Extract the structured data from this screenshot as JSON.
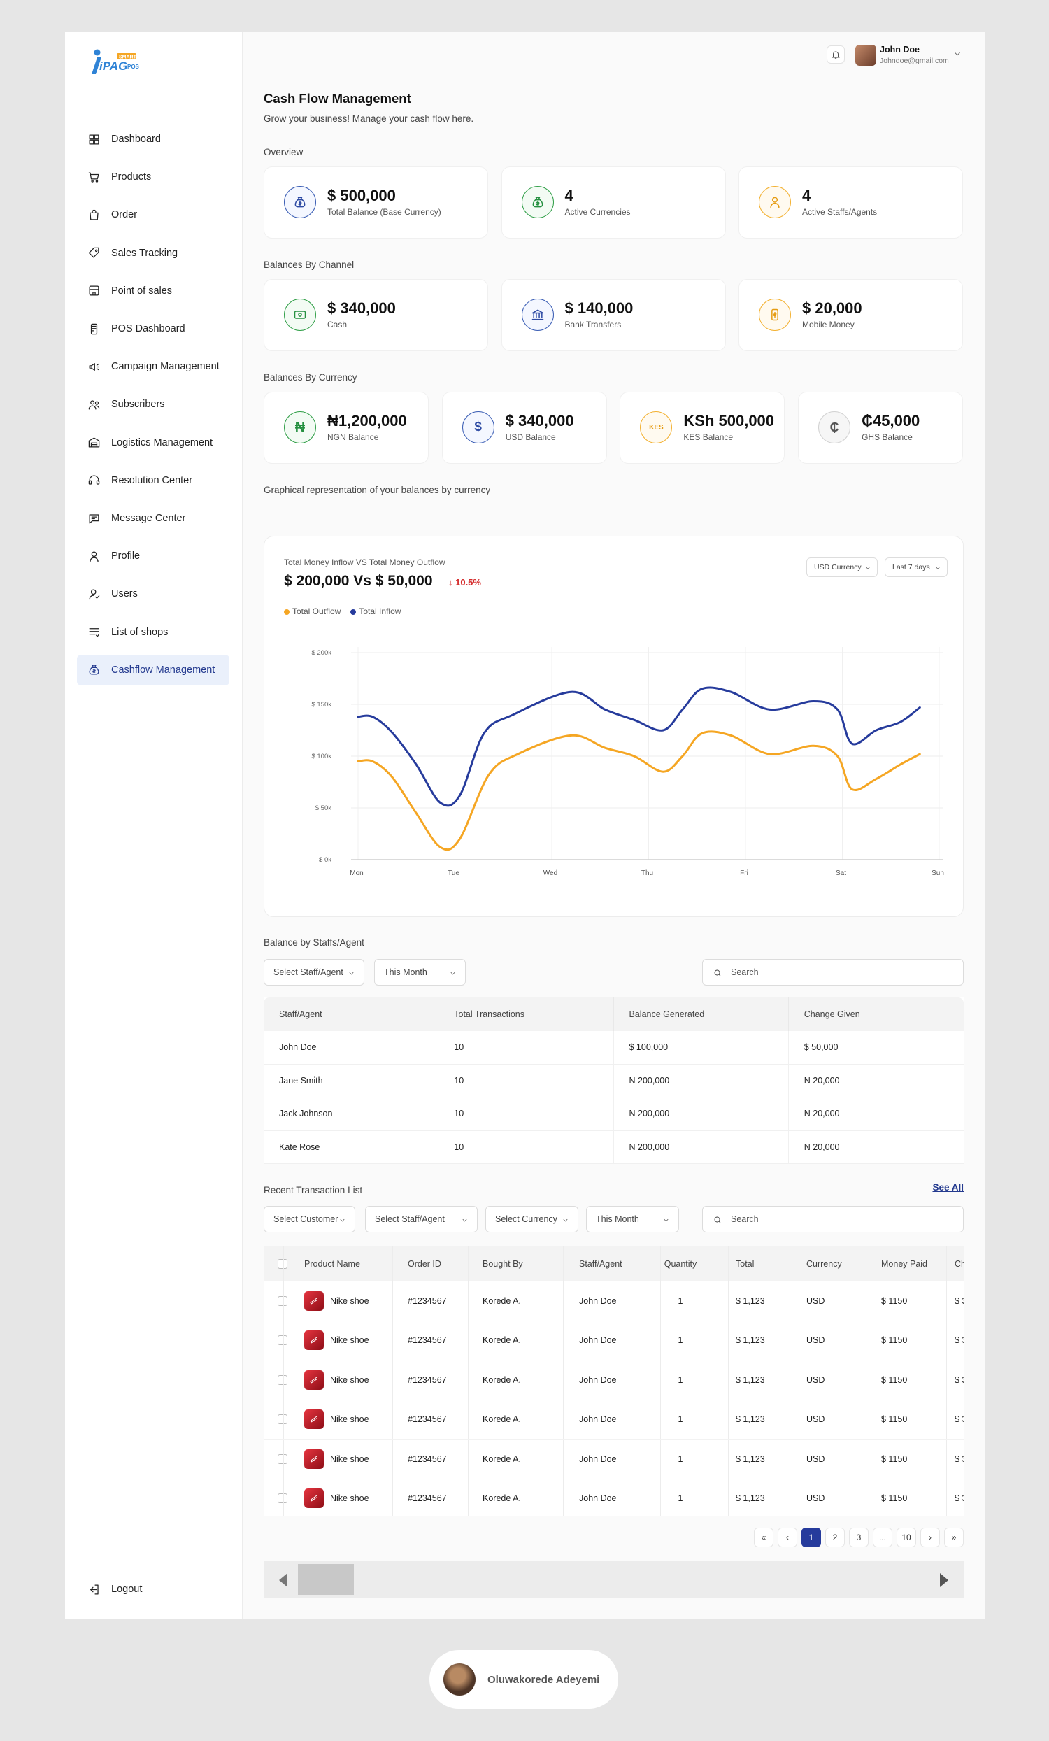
{
  "app": {
    "logo_text": "iPAG",
    "logo_badge": "SMART",
    "logo_sub": "POS"
  },
  "sidebar": {
    "items": [
      {
        "label": "Dashboard",
        "icon": "dashboard-grid-icon"
      },
      {
        "label": "Products",
        "icon": "cart-icon"
      },
      {
        "label": "Order",
        "icon": "shopping-bag-icon"
      },
      {
        "label": "Sales Tracking",
        "icon": "tag-icon"
      },
      {
        "label": "Point of sales",
        "icon": "store-icon"
      },
      {
        "label": "POS Dashboard",
        "icon": "pos-terminal-icon"
      },
      {
        "label": "Campaign Management",
        "icon": "megaphone-icon"
      },
      {
        "label": "Subscribers",
        "icon": "users-icon"
      },
      {
        "label": "Logistics Management",
        "icon": "warehouse-icon"
      },
      {
        "label": "Resolution Center",
        "icon": "headset-icon"
      },
      {
        "label": "Message Center",
        "icon": "message-icon"
      },
      {
        "label": "Profile",
        "icon": "person-icon"
      },
      {
        "label": "Users",
        "icon": "user-icon"
      },
      {
        "label": "List of shops",
        "icon": "list-icon"
      },
      {
        "label": "Cashflow Management",
        "icon": "money-bag-icon",
        "active": true
      }
    ],
    "logout_label": "Logout"
  },
  "topbar": {
    "user_name": "John Doe",
    "user_email": "Johndoe@gmail.com"
  },
  "page": {
    "title": "Cash Flow Management",
    "subtitle": "Grow your business! Manage your cash flow here."
  },
  "overview": {
    "label": "Overview",
    "cards": [
      {
        "value": "$ 500,000",
        "label": "Total Balance (Base Currency)"
      },
      {
        "value": "4",
        "label": "Active Currencies"
      },
      {
        "value": "4",
        "label": "Active Staffs/Agents"
      }
    ]
  },
  "channels": {
    "label": "Balances By Channel",
    "cards": [
      {
        "value": "$ 340,000",
        "label": "Cash"
      },
      {
        "value": "$ 140,000",
        "label": "Bank Transfers"
      },
      {
        "value": "$ 20,000",
        "label": "Mobile Money"
      }
    ]
  },
  "currencies": {
    "label": "Balances By Currency",
    "cards": [
      {
        "value": "₦1,200,000",
        "label": "NGN Balance",
        "symbol": "₦"
      },
      {
        "value": "$ 340,000",
        "label": "USD Balance",
        "symbol": "$"
      },
      {
        "value": "KSh 500,000",
        "label": "KES Balance",
        "symbol": "KES"
      },
      {
        "value": "₵45,000",
        "label": "GHS Balance",
        "symbol": "₵"
      }
    ]
  },
  "graph": {
    "section_label": "Graphical representation of your balances by currency",
    "subtitle": "Total Money Inflow VS Total Money Outflow",
    "headline": "$ 200,000 Vs $ 50,000",
    "delta": "↓ 10.5%",
    "currency_dropdown": "USD Currency",
    "period_dropdown": "Last 7 days"
  },
  "chart_data": {
    "type": "line",
    "title": "",
    "xlabel": "",
    "ylabel": "",
    "x": [
      "Mon",
      "Mon+",
      "Mon++",
      "Tue-",
      "Tue",
      "Tue+",
      "Tue++",
      "Wed-",
      "Wed",
      "Wed+",
      "Wed++",
      "Thu-",
      "Thu",
      "Thu+",
      "Thu++",
      "Fri-",
      "Fri",
      "Fri+",
      "Fri++",
      "Sat-",
      "Sat",
      "Sat+",
      "Sat++",
      "Sun-"
    ],
    "categories": [
      "Mon",
      "Tue",
      "Wed",
      "Thu",
      "Fri",
      "Sat",
      "Sun"
    ],
    "y_ticks": [
      "$ 200k",
      "$ 150k",
      "$ 100k",
      "$ 50k",
      "$ 0k"
    ],
    "ylim": [
      0,
      200000
    ],
    "grid": true,
    "legend_position": "top-left",
    "series": [
      {
        "name": "Total Outflow",
        "color": "#f5a623",
        "values": [
          [
            0,
            95000
          ],
          [
            0.15,
            95000
          ],
          [
            0.35,
            80000
          ],
          [
            0.6,
            45000
          ],
          [
            0.85,
            12000
          ],
          [
            1.05,
            20000
          ],
          [
            1.35,
            82000
          ],
          [
            1.65,
            102000
          ],
          [
            2.2,
            120000
          ],
          [
            2.55,
            108000
          ],
          [
            2.85,
            100000
          ],
          [
            3.15,
            85000
          ],
          [
            3.35,
            100000
          ],
          [
            3.55,
            122000
          ],
          [
            3.85,
            120000
          ],
          [
            4.25,
            102000
          ],
          [
            4.7,
            110000
          ],
          [
            4.95,
            100000
          ],
          [
            5.1,
            68000
          ],
          [
            5.35,
            78000
          ],
          [
            5.6,
            92000
          ],
          [
            5.8,
            102000
          ]
        ]
      },
      {
        "name": "Total Inflow",
        "color": "#263b9c",
        "values": [
          [
            0,
            138000
          ],
          [
            0.15,
            138000
          ],
          [
            0.35,
            123000
          ],
          [
            0.6,
            92000
          ],
          [
            0.85,
            55000
          ],
          [
            1.05,
            62000
          ],
          [
            1.3,
            122000
          ],
          [
            1.6,
            140000
          ],
          [
            2.2,
            162000
          ],
          [
            2.55,
            145000
          ],
          [
            2.85,
            135000
          ],
          [
            3.15,
            125000
          ],
          [
            3.35,
            145000
          ],
          [
            3.55,
            165000
          ],
          [
            3.85,
            162000
          ],
          [
            4.25,
            145000
          ],
          [
            4.7,
            153000
          ],
          [
            4.95,
            145000
          ],
          [
            5.1,
            112000
          ],
          [
            5.35,
            125000
          ],
          [
            5.6,
            133000
          ],
          [
            5.8,
            147000
          ]
        ]
      }
    ]
  },
  "staff_section": {
    "label": "Balance by Staffs/Agent",
    "filter_staff": "Select Staff/Agent",
    "filter_period": "This Month",
    "search_placeholder": "Search",
    "columns": [
      "Staff/Agent",
      "Total Transactions",
      "Balance Generated",
      "Change Given"
    ],
    "rows": [
      [
        "John Doe",
        "10",
        "$ 100,000",
        "$ 50,000"
      ],
      [
        "Jane Smith",
        "10",
        "N 200,000",
        "N 20,000"
      ],
      [
        "Jack Johnson",
        "10",
        "N 200,000",
        "N 20,000"
      ],
      [
        "Kate Rose",
        "10",
        "N 200,000",
        "N 20,000"
      ]
    ]
  },
  "transactions": {
    "label": "Recent Transaction List",
    "see_all": "See All",
    "filters": [
      "Select Customer",
      "Select Staff/Agent",
      "Select Currency",
      "This Month"
    ],
    "search_placeholder": "Search",
    "columns": [
      "Product Name",
      "Order ID",
      "Bought By",
      "Staff/Agent",
      "Quantity",
      "Total",
      "Currency",
      "Money Paid",
      "Ch"
    ],
    "rows": [
      [
        "Nike shoe",
        "#1234567",
        "Korede A.",
        "John Doe",
        "1",
        "$ 1,123",
        "USD",
        "$ 1150",
        "$ 3"
      ],
      [
        "Nike shoe",
        "#1234567",
        "Korede A.",
        "John Doe",
        "1",
        "$ 1,123",
        "USD",
        "$ 1150",
        "$ 3"
      ],
      [
        "Nike shoe",
        "#1234567",
        "Korede A.",
        "John Doe",
        "1",
        "$ 1,123",
        "USD",
        "$ 1150",
        "$ 3"
      ],
      [
        "Nike shoe",
        "#1234567",
        "Korede A.",
        "John Doe",
        "1",
        "$ 1,123",
        "USD",
        "$ 1150",
        "$ 3"
      ],
      [
        "Nike shoe",
        "#1234567",
        "Korede A.",
        "John Doe",
        "1",
        "$ 1,123",
        "USD",
        "$ 1150",
        "$ 3"
      ],
      [
        "Nike shoe",
        "#1234567",
        "Korede A.",
        "John Doe",
        "1",
        "$ 1,123",
        "USD",
        "$ 1150",
        "$ 3"
      ]
    ]
  },
  "pagination": {
    "pages": [
      "«",
      "‹",
      "1",
      "2",
      "3",
      "...",
      "10",
      "›",
      "»"
    ],
    "current": "1"
  },
  "author": {
    "name": "Oluwakorede Adeyemi"
  }
}
